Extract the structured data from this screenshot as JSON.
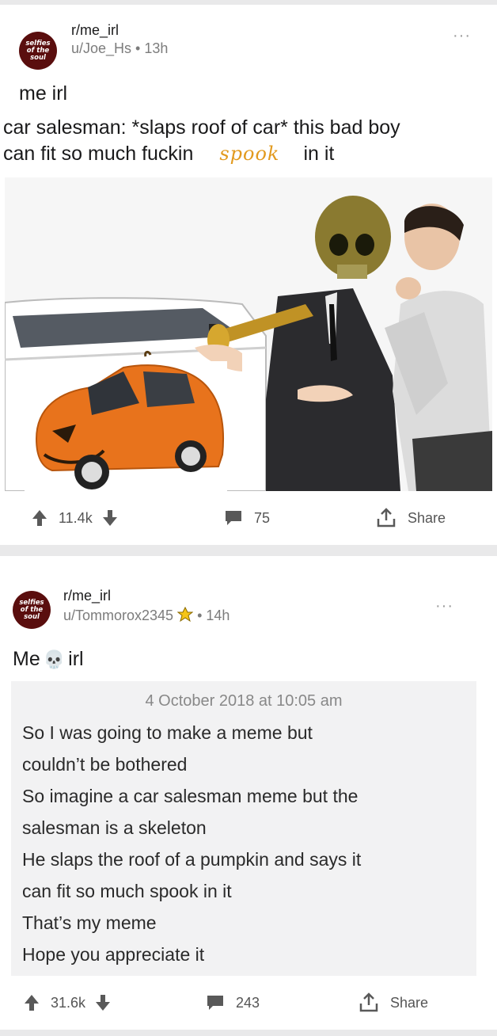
{
  "post1": {
    "avatar_text": "selfies of the soul",
    "subreddit": "r/me_irl",
    "user": "u/Joe_Hs",
    "time": "13h",
    "more": "···",
    "title": "me irl",
    "caption_line1": "car salesman: *slaps roof of car* this bad boy",
    "caption_line2_a": "can fit so much fuckin",
    "caption_word": "spook",
    "caption_line2_b": "in it",
    "upvotes": "11.4k",
    "comments": "75",
    "share": "Share"
  },
  "post2": {
    "avatar_text": "selfies of the soul",
    "subreddit": "r/me_irl",
    "user": "u/Tommorox2345",
    "time": "14h",
    "more": "···",
    "title_a": "Me",
    "title_emoji": "💀",
    "title_b": "irl",
    "note_date": "4 October 2018 at 10:05 am",
    "note_lines": [
      "So I was going to make a meme but",
      "couldn’t be bothered",
      "So imagine a car salesman meme but the",
      "salesman is a skeleton",
      "He slaps the roof of a pumpkin and says it",
      "can fit so much spook in it",
      "That’s my meme",
      "Hope you appreciate it"
    ],
    "upvotes": "31.6k",
    "comments": "243",
    "share": "Share"
  },
  "colors": {
    "avatar": "#5a0e0e",
    "spook": "#e29a1e",
    "pumpkin": "#e8731c",
    "skull": "#8a7a30"
  },
  "icons": [
    "upvote-arrow-icon",
    "downvote-arrow-icon",
    "comment-bubble-icon",
    "share-icon",
    "more-options-icon",
    "award-icon",
    "skull-emoji"
  ]
}
